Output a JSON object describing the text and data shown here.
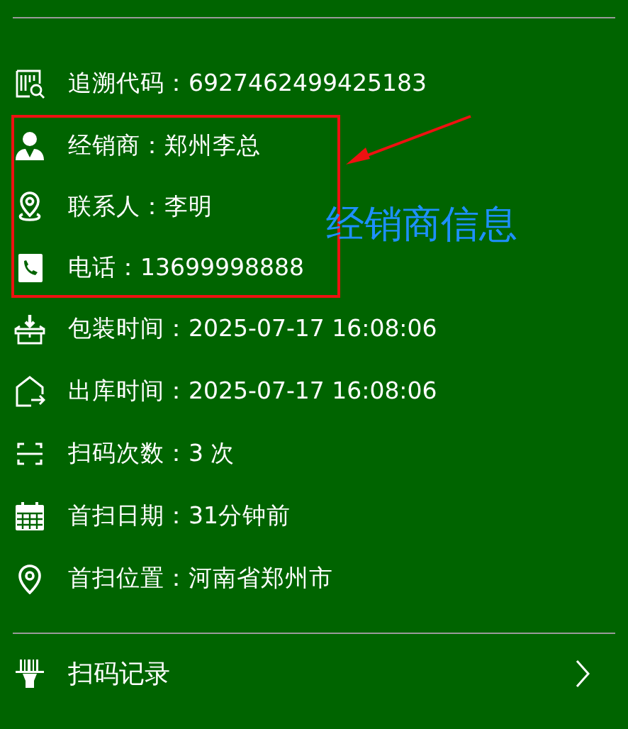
{
  "rows": [
    {
      "kind": "trace",
      "label": "追溯代码：",
      "value": "6927462499425183",
      "highlighted": false
    },
    {
      "kind": "dealer",
      "label": "经销商：",
      "value": "郑州李总",
      "highlighted": true
    },
    {
      "kind": "contact",
      "label": "联系人：",
      "value": "李明",
      "highlighted": true
    },
    {
      "kind": "phone",
      "label": "电话：",
      "value": "13699998888",
      "highlighted": true
    },
    {
      "kind": "pack",
      "label": "包装时间：",
      "value": "2025-07-17 16:08:06",
      "highlighted": false
    },
    {
      "kind": "out",
      "label": "出库时间：",
      "value": "2025-07-17 16:08:06",
      "highlighted": false
    },
    {
      "kind": "scan",
      "label": "扫码次数：",
      "value": "3 次",
      "highlighted": false
    },
    {
      "kind": "date",
      "label": "首扫日期：",
      "value": "31分钟前",
      "highlighted": false
    },
    {
      "kind": "place",
      "label": "首扫位置：",
      "value": "河南省郑州市",
      "highlighted": false
    }
  ],
  "annotation": {
    "text": "经销商信息"
  },
  "footer": {
    "label": "扫码记录"
  }
}
